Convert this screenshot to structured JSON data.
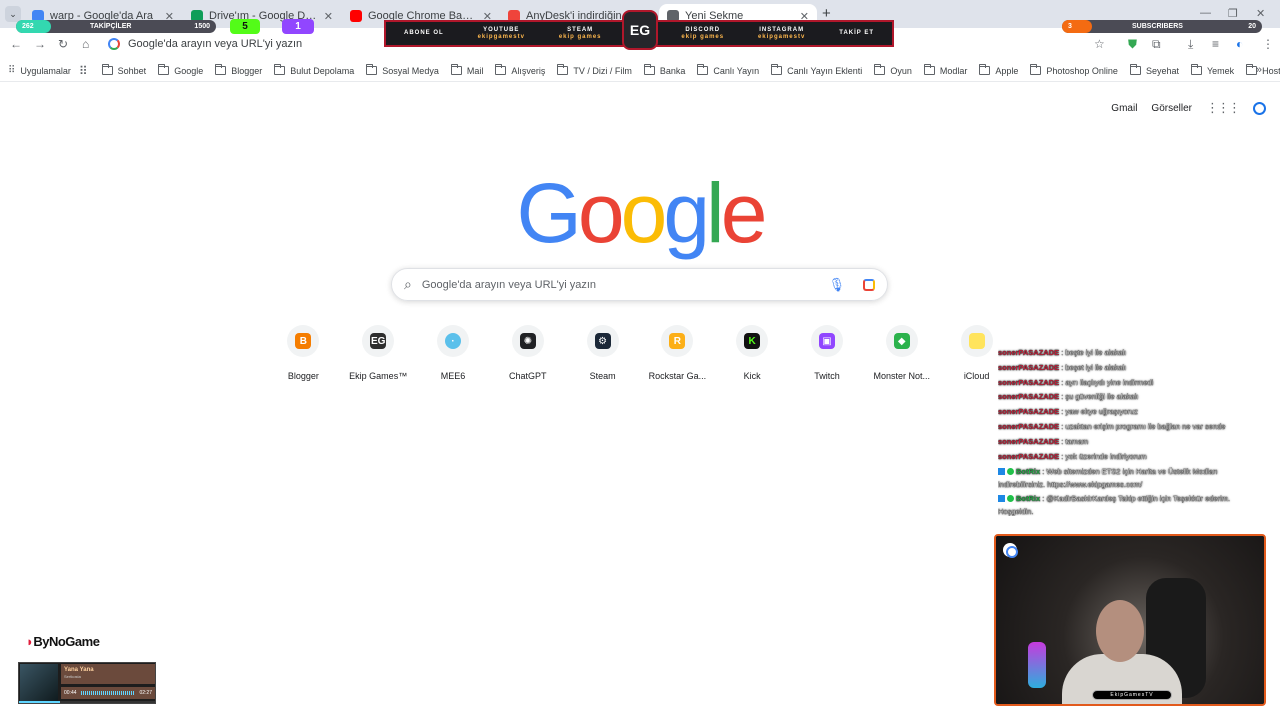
{
  "browser": {
    "tabs": [
      {
        "title": "warp - Google'da Ara",
        "favicon": "google-g-icon",
        "color": "#4285f4"
      },
      {
        "title": "Drive'ım - Google Drive",
        "favicon": "google-drive-icon",
        "color": "#0f9d58"
      },
      {
        "title": "Google Chrome Başarısız virüs",
        "favicon": "youtube-icon",
        "color": "#ff0000"
      },
      {
        "title": "AnyDesk'i indirdiğiniz için te",
        "favicon": "anydesk-icon",
        "color": "#ef443b"
      },
      {
        "title": "Yeni Sekme",
        "favicon": "chrome-icon",
        "color": "#5f6368",
        "active": true
      }
    ],
    "omnibox_placeholder": "Google'da arayın veya URL'yi yazın",
    "bookmarks": [
      {
        "label": "Uygulamalar",
        "icon": "apps-grid-icon"
      },
      {
        "label": "Sohbet",
        "icon": "folder-icon"
      },
      {
        "label": "Google",
        "icon": "folder-icon"
      },
      {
        "label": "Blogger",
        "icon": "folder-icon"
      },
      {
        "label": "Bulut Depolama",
        "icon": "folder-icon"
      },
      {
        "label": "Sosyal Medya",
        "icon": "folder-icon"
      },
      {
        "label": "Mail",
        "icon": "folder-icon"
      },
      {
        "label": "Alışveriş",
        "icon": "folder-icon"
      },
      {
        "label": "TV / Dizi / Film",
        "icon": "folder-icon"
      },
      {
        "label": "Banka",
        "icon": "folder-icon"
      },
      {
        "label": "Canlı Yayın",
        "icon": "folder-icon"
      },
      {
        "label": "Canlı Yayın Eklenti",
        "icon": "folder-icon"
      },
      {
        "label": "Oyun",
        "icon": "folder-icon"
      },
      {
        "label": "Modlar",
        "icon": "folder-icon"
      },
      {
        "label": "Apple",
        "icon": "folder-icon"
      },
      {
        "label": "Photoshop Online",
        "icon": "folder-icon"
      },
      {
        "label": "Seyehat",
        "icon": "folder-icon"
      },
      {
        "label": "Yemek",
        "icon": "folder-icon"
      },
      {
        "label": "Hosting",
        "icon": "folder-icon"
      }
    ]
  },
  "google": {
    "links": {
      "gmail": "Gmail",
      "images": "Görseller"
    },
    "logo": [
      "G",
      "o",
      "o",
      "g",
      "l",
      "e"
    ],
    "logo_colors": [
      "#4285f4",
      "#ea4335",
      "#fbbc05",
      "#4285f4",
      "#34a853",
      "#ea4335"
    ],
    "search_placeholder": "Google'da arayın veya URL'yi yazın",
    "shortcuts": [
      {
        "label": "Blogger",
        "icon": "blogger-icon",
        "glyph": "B",
        "color": "#f57d00"
      },
      {
        "label": "Ekip Games™",
        "icon": "ekip-games-icon",
        "glyph": "EG",
        "color": "#2e2e2e"
      },
      {
        "label": "MEE6",
        "icon": "mee6-icon",
        "glyph": "·",
        "color": "#5bc0eb"
      },
      {
        "label": "ChatGPT",
        "icon": "chatgpt-icon",
        "glyph": "✺",
        "color": "#202124"
      },
      {
        "label": "Steam",
        "icon": "steam-icon",
        "glyph": "⚙",
        "color": "#1b2838"
      },
      {
        "label": "Rockstar Ga...",
        "icon": "rockstar-icon",
        "glyph": "R",
        "color": "#fcaf17"
      },
      {
        "label": "Kick",
        "icon": "kick-icon",
        "glyph": "K",
        "color": "#111"
      },
      {
        "label": "Twitch",
        "icon": "twitch-icon",
        "glyph": "▣",
        "color": "#9146ff"
      },
      {
        "label": "Monster Not...",
        "icon": "monster-notebook-icon",
        "glyph": "◆",
        "color": "#2bb24c"
      },
      {
        "label": "iCloud",
        "icon": "icloud-icon",
        "glyph": "",
        "color": "#ffe45c"
      }
    ]
  },
  "overlay": {
    "followers": {
      "current": "262",
      "label": "TAKİPÇİLER",
      "goal": "1500",
      "progress": 0.175
    },
    "kick_count": "5",
    "twitch_count": "1",
    "banner": [
      {
        "line1": "ABONE OL",
        "line2": ""
      },
      {
        "line1": "YOUTUBE",
        "line2": "ekipgamestv"
      },
      {
        "line1": "STEAM",
        "line2": "ekip games"
      },
      {
        "line1": "DISCORD",
        "line2": "ekip games"
      },
      {
        "line1": "INSTAGRAM",
        "line2": "ekipgamestv"
      },
      {
        "line1": "TAKİP ET",
        "line2": ""
      }
    ],
    "banner_logo": "EG",
    "subs": {
      "current": "3",
      "label": "SUBSCRIBERS",
      "goal": "20",
      "progress": 0.15
    },
    "chat": [
      {
        "user": "sonerPASAZADE",
        "text": " : beşte iyi ile alakalı"
      },
      {
        "user": "sonerPASAZADE",
        "text": " : beşet iyi ile alakalı"
      },
      {
        "user": "sonerPASAZADE",
        "text": " : ayrı ilaçlıydı yine indirmedi"
      },
      {
        "user": "sonerPASAZADE",
        "text": " : şu güvenliği ile alakalı"
      },
      {
        "user": "sonerPASAZADE",
        "text": " : yaw ekye uğraşıyoruz"
      },
      {
        "user": "sonerPASAZADE",
        "text": " : uzaktan erişim programı ile bağlan ne var sende"
      },
      {
        "user": "sonerPASAZADE",
        "text": " : tamam"
      },
      {
        "user": "sonerPASAZADE",
        "text": " : yok üzerinde indiriyorum"
      },
      {
        "user": "BotRix",
        "text": " : Web sitemizden ETS2 için Harita ve Üstelik Modları indirebilirsiniz. https://www.ekipgames.com/",
        "bot": true
      },
      {
        "user": "BotRix",
        "text": " : @KadirBaskirKardeş Takip ettiğin için Teşekkür ederim. Hoşgeldin.",
        "bot": true
      }
    ],
    "cam_label": "EkipGamesTV",
    "bynogame": "ByNoGame",
    "music": {
      "title": "Yana Yana",
      "artist": "Sertkosta",
      "elapsed": "00:44",
      "total": "02:27",
      "progress": 0.3
    }
  }
}
